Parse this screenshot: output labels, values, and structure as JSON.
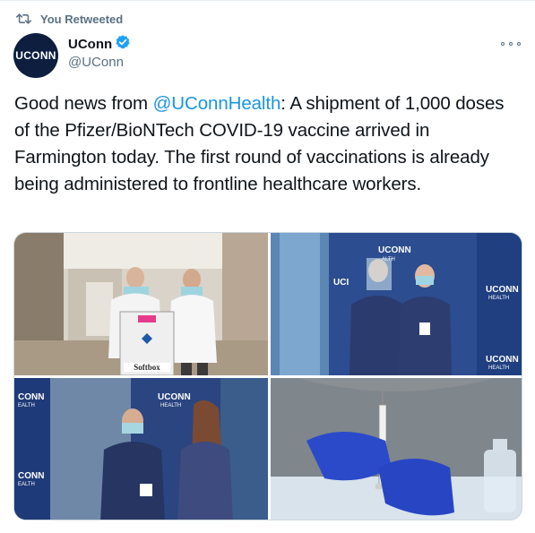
{
  "retweet": {
    "label": "You Retweeted",
    "icon": "retweet-icon"
  },
  "author": {
    "display_name": "UConn",
    "handle": "@UConn",
    "avatar_text": "UCONN",
    "verified": true,
    "avatar_color": "#0d1e3f"
  },
  "tweet": {
    "text_before": "Good news from ",
    "mention": "@UConnHealth",
    "text_after": ": A shipment of 1,000 doses of the Pfizer/BioNTech COVID-19 vaccine arrived in Farmington today. The first round of vaccinations is already being administered to frontline healthcare workers."
  },
  "media": {
    "photos": [
      {
        "name": "hallway-shipment-photo",
        "signs": [
          "Softbox"
        ]
      },
      {
        "name": "vaccination-female-photo",
        "signs": [
          "UCONN",
          "HEALTH",
          "UCONN",
          "HEALTH",
          "UCONN",
          "HEALTH"
        ]
      },
      {
        "name": "vaccination-male-photo",
        "signs": [
          "UCONN",
          "HEALTH",
          "CONN",
          "EALTH",
          "CONN",
          "EALTH"
        ]
      },
      {
        "name": "syringe-closeup-photo",
        "signs": []
      }
    ]
  },
  "colors": {
    "accent": "#1b95e0",
    "secondary_text": "#5b7083",
    "verified_badge": "#1da1f2"
  }
}
